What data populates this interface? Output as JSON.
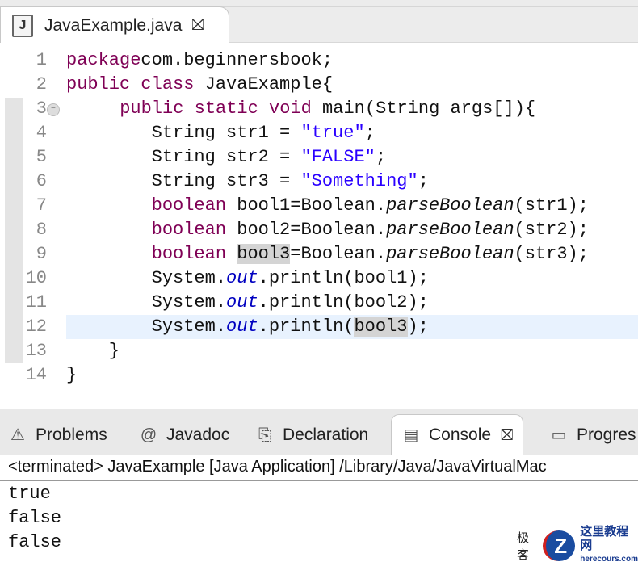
{
  "editor_tab": {
    "icon": "java-file-icon",
    "title": "JavaExample.java",
    "close": "⛝"
  },
  "lines": [
    {
      "n": "1",
      "parts": [
        [
          "kw",
          "package"
        ],
        [
          "",
          "com.beginnersbook;"
        ]
      ]
    },
    {
      "n": "2",
      "parts": [
        [
          "kw",
          "public"
        ],
        [
          "",
          " "
        ],
        [
          "kw",
          "class"
        ],
        [
          "",
          " JavaExample{"
        ]
      ]
    },
    {
      "n": "3",
      "parts": [
        [
          "",
          " "
        ],
        [
          "kw",
          "public"
        ],
        [
          "",
          " "
        ],
        [
          "kw",
          "static"
        ],
        [
          "",
          " "
        ],
        [
          "kw",
          "void"
        ],
        [
          "",
          " main(String args[]){"
        ]
      ]
    },
    {
      "n": "4",
      "parts": [
        [
          "",
          "        String str1 = "
        ],
        [
          "str",
          "\"true\""
        ],
        [
          "",
          ";"
        ]
      ]
    },
    {
      "n": "5",
      "parts": [
        [
          "",
          "        String str2 = "
        ],
        [
          "str",
          "\"FALSE\""
        ],
        [
          "",
          ";"
        ]
      ]
    },
    {
      "n": "6",
      "parts": [
        [
          "",
          "        String str3 = "
        ],
        [
          "str",
          "\"Something\""
        ],
        [
          "",
          ";"
        ]
      ]
    },
    {
      "n": "7",
      "parts": [
        [
          "",
          "        "
        ],
        [
          "kw",
          "boolean"
        ],
        [
          "",
          " bool1=Boolean."
        ],
        [
          "it",
          "parseBoolean"
        ],
        [
          "",
          "(str1);"
        ]
      ]
    },
    {
      "n": "8",
      "parts": [
        [
          "",
          "        "
        ],
        [
          "kw",
          "boolean"
        ],
        [
          "",
          " bool2=Boolean."
        ],
        [
          "it",
          "parseBoolean"
        ],
        [
          "",
          "(str2);"
        ]
      ]
    },
    {
      "n": "9",
      "parts": [
        [
          "",
          "        "
        ],
        [
          "kw",
          "boolean"
        ],
        [
          "",
          " "
        ],
        [
          "occ",
          "bool3"
        ],
        [
          "",
          "=Boolean."
        ],
        [
          "it",
          "parseBoolean"
        ],
        [
          "",
          "(str3);"
        ]
      ]
    },
    {
      "n": "10",
      "parts": [
        [
          "",
          "        System."
        ],
        [
          "fld",
          "out"
        ],
        [
          "",
          ".println(bool1);"
        ]
      ]
    },
    {
      "n": "11",
      "parts": [
        [
          "",
          "        System."
        ],
        [
          "fld",
          "out"
        ],
        [
          "",
          ".println(bool2);"
        ]
      ]
    },
    {
      "n": "12",
      "parts": [
        [
          "",
          "        System."
        ],
        [
          "fld",
          "out"
        ],
        [
          "",
          ".println("
        ],
        [
          "occ",
          "bool3"
        ],
        [
          "",
          ");"
        ]
      ]
    },
    {
      "n": "13",
      "parts": [
        [
          "",
          "    }"
        ]
      ]
    },
    {
      "n": "14",
      "parts": [
        [
          "",
          "}"
        ]
      ]
    }
  ],
  "panel": {
    "tabs": [
      {
        "label": "Problems",
        "icon": "problems-icon",
        "glyph": "⚠"
      },
      {
        "label": "Javadoc",
        "icon": "at-icon",
        "glyph": "@"
      },
      {
        "label": "Declaration",
        "icon": "declaration-icon",
        "glyph": "⎘"
      },
      {
        "label": "Console",
        "icon": "console-icon",
        "glyph": "▤",
        "close": "⛝"
      },
      {
        "label": "Progres",
        "icon": "progress-icon",
        "glyph": "▭"
      }
    ],
    "status": "<terminated> JavaExample [Java Application] /Library/Java/JavaVirtualMac",
    "output": [
      "true",
      "false",
      "false"
    ]
  },
  "logo": {
    "mark": "Z",
    "title": "这里教程网",
    "url": "herecours.com",
    "prefix": "极客"
  }
}
